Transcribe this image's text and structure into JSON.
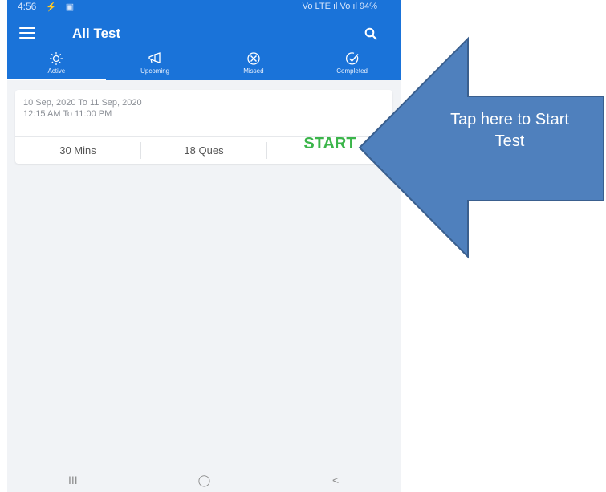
{
  "status_bar": {
    "time": "4:56",
    "left_icons": "⚡ ▣",
    "right": "Vo LTE ıl Vo ıl 94%"
  },
  "app_bar": {
    "title": "All Test"
  },
  "tabs": [
    {
      "label": "Active",
      "icon": "sun-icon",
      "active": true
    },
    {
      "label": "Upcoming",
      "icon": "megaphone-icon",
      "active": false
    },
    {
      "label": "Missed",
      "icon": "missed-icon",
      "active": false
    },
    {
      "label": "Completed",
      "icon": "check-circle-icon",
      "active": false
    }
  ],
  "test_card": {
    "date_range": "10 Sep, 2020 To 11 Sep, 2020",
    "time_range": "12:15 AM To 11:00 PM",
    "duration": "30 Mins",
    "questions": "18 Ques",
    "start_label": "START"
  },
  "nav_bar": {
    "recents": "III",
    "home": "◯",
    "back": "<"
  },
  "callout": {
    "text_line1": "Tap here to Start",
    "text_line2": "Test"
  },
  "colors": {
    "app_bar": "#1a73d9",
    "start_green": "#3bb54a",
    "callout_fill": "#4f80bd",
    "callout_stroke": "#3a5f8e",
    "background": "#f1f3f6"
  }
}
